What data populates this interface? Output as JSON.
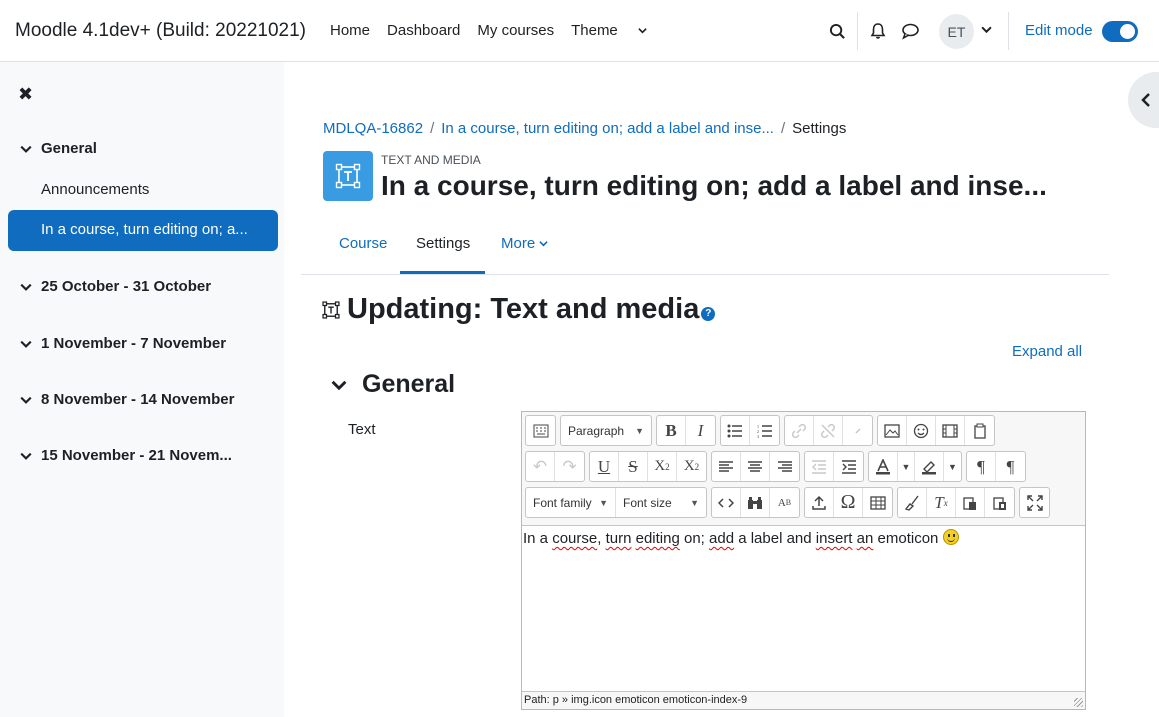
{
  "navbar": {
    "brand": "Moodle 4.1dev+ (Build: 20221021)",
    "links": [
      "Home",
      "Dashboard",
      "My courses"
    ],
    "theme_label": "Theme",
    "avatar_initials": "ET",
    "edit_mode_label": "Edit mode",
    "edit_mode_on": true
  },
  "drawer": {
    "sections": [
      {
        "label": "General"
      },
      {
        "label": "25 October - 31 October"
      },
      {
        "label": "1 November - 7 November"
      },
      {
        "label": "8 November - 14 November"
      },
      {
        "label": "15 November - 21 Novem..."
      }
    ],
    "items": [
      {
        "label": "Announcements"
      },
      {
        "label": "In a course, turn editing on; a..."
      }
    ]
  },
  "breadcrumb": {
    "items": [
      "MDLQA-16862",
      "In a course, turn editing on; add a label and inse...",
      "Settings"
    ]
  },
  "page": {
    "module_type": "TEXT AND MEDIA",
    "title": "In a course, turn editing on; add a label and inse...",
    "tabs": [
      "Course",
      "Settings",
      "More"
    ],
    "updating_heading": "Updating: Text and media",
    "expand_all": "Expand all",
    "general_heading": "General",
    "text_label": "Text"
  },
  "editor": {
    "paragraph_select": "Paragraph",
    "font_family_select": "Font family",
    "font_size_select": "Font size",
    "content_words": [
      "In a",
      "course",
      ",",
      "turn",
      "editing",
      "on;",
      "add",
      "a label and",
      "insert",
      "an",
      "emoticon"
    ],
    "path": "Path: p » img.icon emoticon emoticon-index-9"
  },
  "colors": {
    "primary": "#0f6cbf",
    "module_icon": "#399be2"
  }
}
